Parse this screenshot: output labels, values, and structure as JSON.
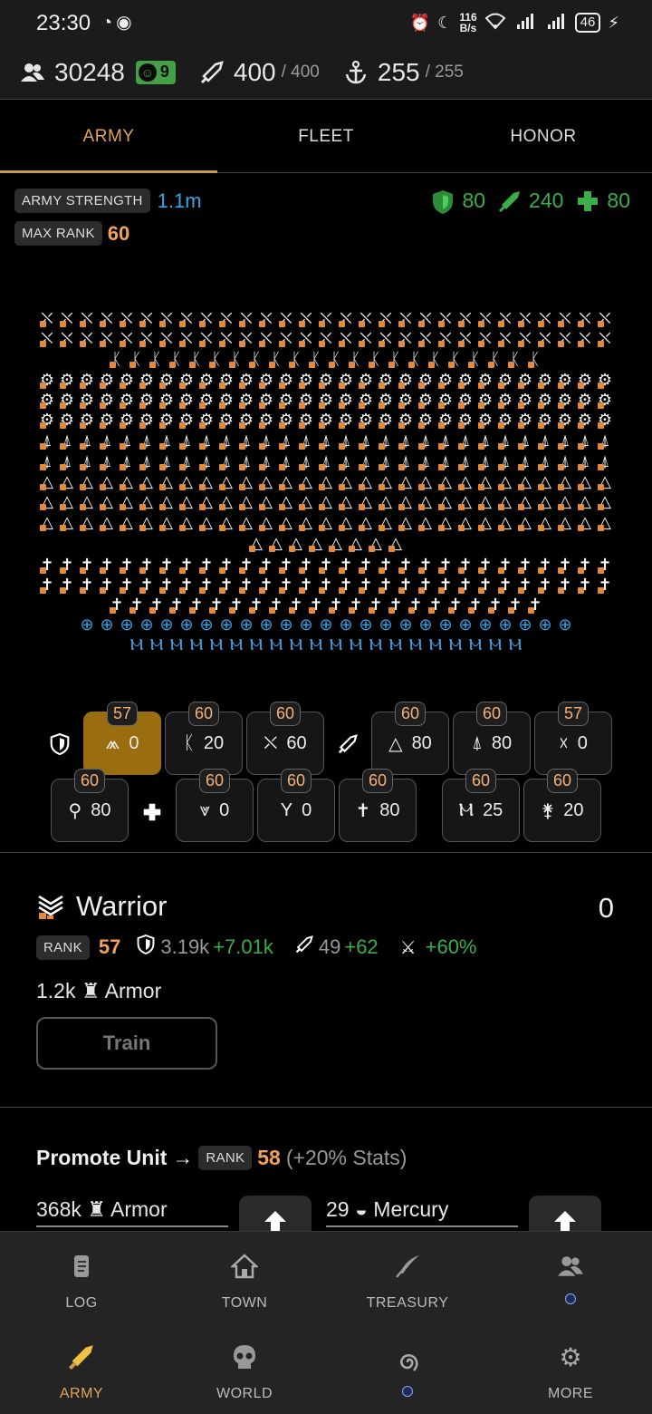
{
  "status_bar": {
    "time": "23:30",
    "net_speed_top": "116",
    "net_speed_bottom": "B/s",
    "battery": "46"
  },
  "resources": {
    "population": "30248",
    "happiness": "9",
    "attack": "400",
    "attack_max": "/ 400",
    "fleet": "255",
    "fleet_max": "/ 255"
  },
  "tabs": [
    {
      "label": "ARMY",
      "active": true
    },
    {
      "label": "FLEET",
      "active": false
    },
    {
      "label": "HONOR",
      "active": false
    }
  ],
  "army": {
    "strength_label": "ARMY STRENGTH",
    "strength_value": "1.1m",
    "max_rank_label": "MAX RANK",
    "max_rank_value": "60",
    "defense_bonus": "80",
    "attack_bonus": "240",
    "health_bonus": "80"
  },
  "formation_rows": [
    {
      "glyph": "⛌",
      "count": 29
    },
    {
      "glyph": "⛌",
      "count": 29
    },
    {
      "glyph": "ᛕ",
      "count": 22
    },
    {
      "glyph": "⚙",
      "count": 29
    },
    {
      "glyph": "⚙",
      "count": 29
    },
    {
      "glyph": "⚙",
      "count": 29
    },
    {
      "glyph": "⍋",
      "count": 29
    },
    {
      "glyph": "⍋",
      "count": 29
    },
    {
      "glyph": "△",
      "count": 29
    },
    {
      "glyph": "△",
      "count": 29
    },
    {
      "glyph": "△",
      "count": 29
    },
    {
      "glyph": "△",
      "count": 8
    },
    {
      "glyph": "✝",
      "count": 29
    },
    {
      "glyph": "✝",
      "count": 29
    },
    {
      "glyph": "✝",
      "count": 22
    },
    {
      "glyph": "⊕",
      "count": 25,
      "blue": true
    },
    {
      "glyph": "Ⲙ",
      "count": 20,
      "blue": true
    }
  ],
  "units_row1": [
    {
      "name": "warrior",
      "icon": "⩕",
      "rank": "57",
      "count": "0",
      "selected": true
    },
    {
      "name": "spearman",
      "icon": "ᛕ",
      "rank": "60",
      "count": "20"
    },
    {
      "name": "swordsman",
      "icon": "⛌",
      "rank": "60",
      "count": "60"
    },
    {
      "name": "archer",
      "icon": "△",
      "rank": "60",
      "count": "80"
    },
    {
      "name": "crossbow",
      "icon": "⍋",
      "rank": "60",
      "count": "80"
    },
    {
      "name": "knight",
      "icon": "☓",
      "rank": "57",
      "count": "0"
    }
  ],
  "units_row2": [
    {
      "name": "scout",
      "icon": "⚲",
      "rank": "60",
      "count": "80"
    },
    {
      "name": "cleric",
      "icon": "⩔",
      "rank": "60",
      "count": "0"
    },
    {
      "name": "monk",
      "icon": "Y",
      "rank": "60",
      "count": "0"
    },
    {
      "name": "paladin",
      "icon": "✝",
      "rank": "60",
      "count": "80"
    },
    {
      "name": "druid",
      "icon": "Ⲙ",
      "rank": "60",
      "count": "25"
    },
    {
      "name": "mage",
      "icon": "⚵",
      "rank": "60",
      "count": "20"
    }
  ],
  "warrior": {
    "name": "Warrior",
    "count": "0",
    "rank_label": "RANK",
    "rank": "57",
    "defense": "3.19k",
    "defense_bonus": "+7.01k",
    "attack": "49",
    "attack_bonus": "+62",
    "special_bonus": "+60%",
    "cost": "1.2k",
    "cost_resource": "Armor",
    "train_label": "Train"
  },
  "promote": {
    "title": "Promote Unit",
    "arrow": "→",
    "rank_label": "RANK",
    "rank": "58",
    "stats_bonus": "(+20% Stats)",
    "req1_amount": "368k",
    "req1_resource": "Armor",
    "req2_amount": "29",
    "req2_resource": "Mercury"
  },
  "nav": {
    "log": "LOG",
    "town": "TOWN",
    "treasury": "TREASURY",
    "army": "ARMY",
    "world": "WORLD",
    "more": "MORE"
  }
}
